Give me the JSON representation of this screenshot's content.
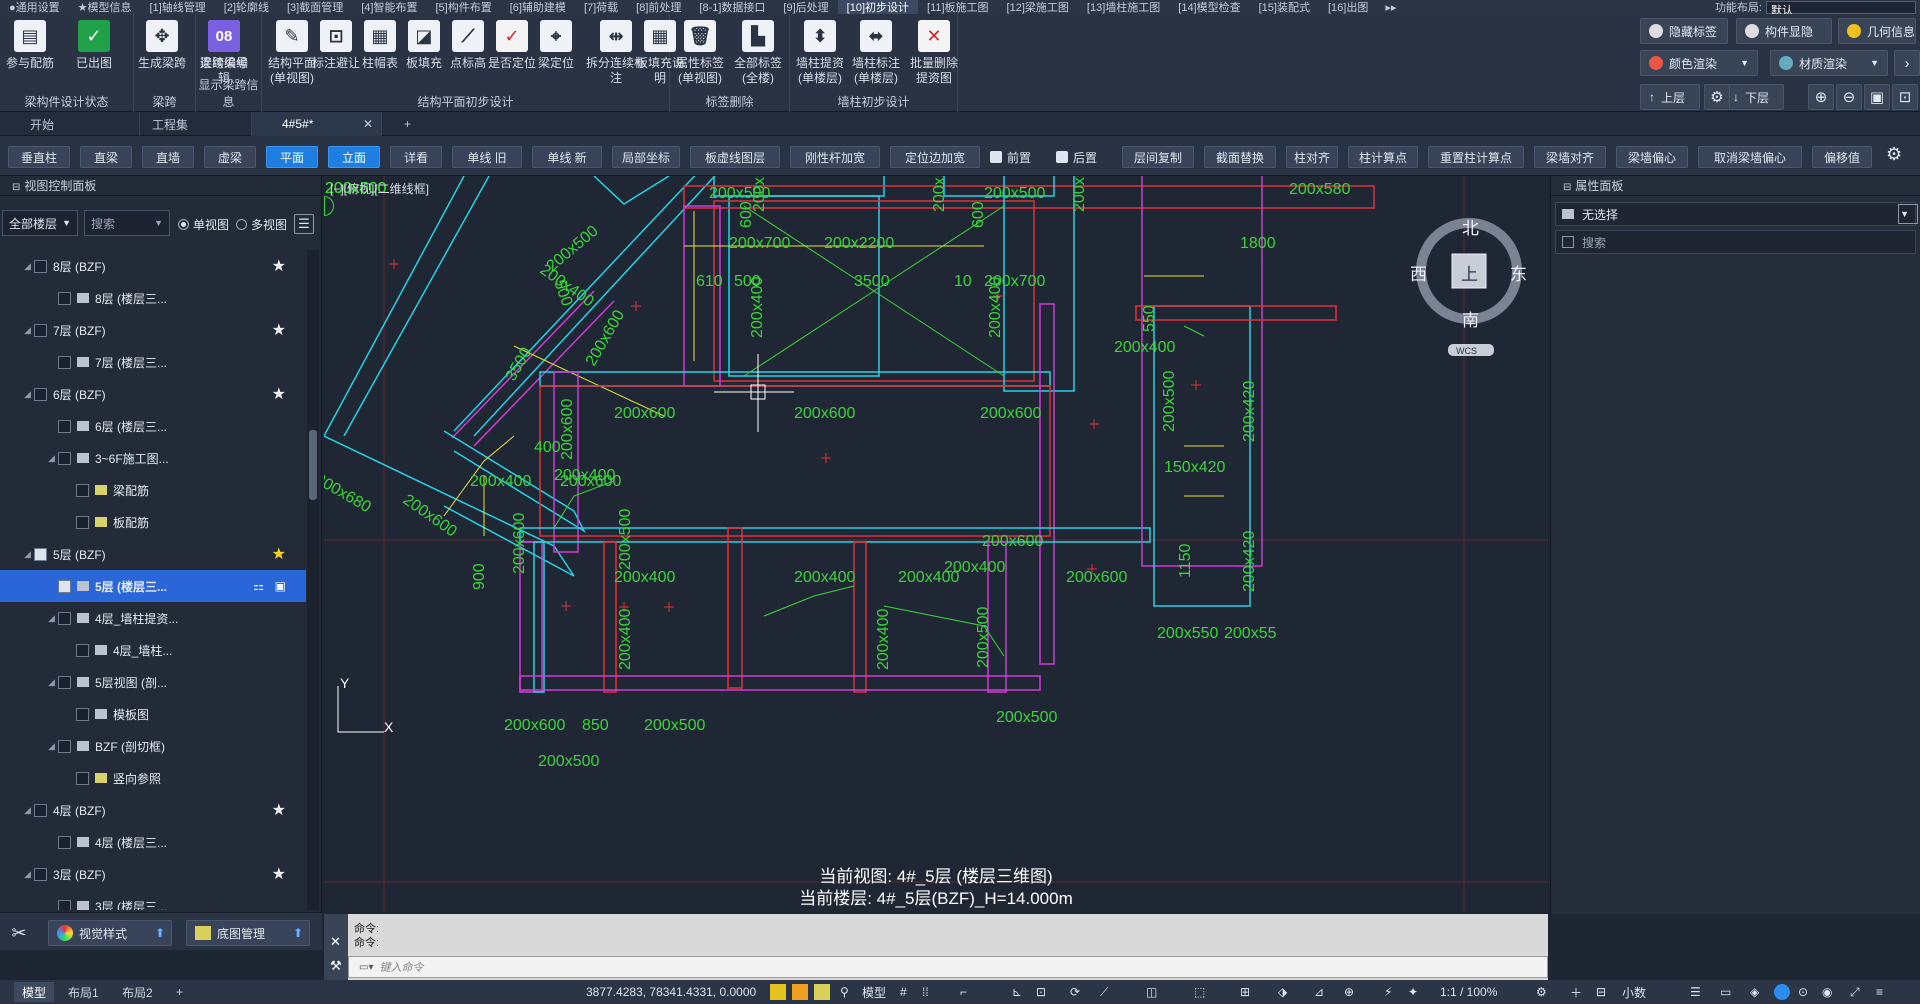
{
  "ribbon_tabs": [
    "●通用设置",
    "★模型信息",
    "[1]轴线管理",
    "[2]轮廓线",
    "[3]截面管理",
    "[4]智能布置",
    "[5]构件布置",
    "[6]辅助建模",
    "[7]荷载",
    "[8]前处理",
    "[8-1]数据接口",
    "[9]后处理",
    "[10]初步设计",
    "[11]板施工图",
    "[12]梁施工图",
    "[13]墙柱施工图",
    "[14]模型检查",
    "[15]装配式",
    "[16]出图"
  ],
  "ribbon_more": "▸▸",
  "layout_label": "功能布局:",
  "layout_value": "默认",
  "ribbon_groups": [
    {
      "label": "梁构件设计状态",
      "buttons": [
        {
          "label": "参与配筋",
          "icon": "reinforcement-icon",
          "glyph": "▤"
        },
        {
          "label": "已出图",
          "icon": "checked-icon",
          "glyph": "✓"
        }
      ]
    },
    {
      "label": "梁跨",
      "buttons": [
        {
          "label": "生成梁跨",
          "icon": "generate-span-icon",
          "glyph": "✥"
        },
        {
          "label": "连续梁编辑",
          "icon": "edit-beam-icon",
          "glyph": "✎"
        }
      ]
    },
    {
      "label": "显示梁跨信息",
      "buttons": [
        {
          "label": "梁跨编号",
          "icon": "span-number-icon",
          "glyph": "08"
        }
      ]
    },
    {
      "label": "结构平面初步设计",
      "buttons": [
        {
          "label": "结构平面(单视图)",
          "icon": "struct-plan-icon",
          "glyph": "✎"
        },
        {
          "label": "标注避让",
          "icon": "annotation-avoid-icon",
          "glyph": "⊡"
        },
        {
          "label": "柱帽表",
          "icon": "column-cap-icon",
          "glyph": "▦"
        },
        {
          "label": "板填充",
          "icon": "slab-fill-icon",
          "glyph": "◪"
        },
        {
          "label": "点标高",
          "icon": "point-elevation-icon",
          "glyph": "⟋"
        },
        {
          "label": "是否定位",
          "icon": "locate-check-icon",
          "glyph": "✓"
        },
        {
          "label": "梁定位",
          "icon": "beam-locate-icon",
          "glyph": "⌖"
        },
        {
          "label": "拆分连续标注",
          "icon": "split-dim-icon",
          "glyph": "⇹"
        },
        {
          "label": "板填充说明",
          "icon": "fill-legend-icon",
          "glyph": "▦"
        }
      ]
    },
    {
      "label": "标签删除",
      "buttons": [
        {
          "label": "属性标签(单视图)",
          "icon": "delete-label-icon",
          "glyph": "🗑"
        },
        {
          "label": "全部标签(全楼)",
          "icon": "delete-all-labels-icon",
          "glyph": "▙"
        }
      ]
    },
    {
      "label": "墙柱初步设计",
      "buttons": [
        {
          "label": "墙柱提资(单楼层)",
          "icon": "wall-column-data-icon",
          "glyph": "⬍"
        },
        {
          "label": "墙柱标注(单楼层)",
          "icon": "wall-column-dim-icon",
          "glyph": "⬌"
        },
        {
          "label": "批量删除提资图",
          "icon": "batch-delete-icon",
          "glyph": "✕"
        }
      ]
    }
  ],
  "right_ribbon": {
    "hide_label": "隐藏标签",
    "component_show": "构件显隐",
    "geometry_info": "几何信息",
    "color_render": "颜色渲染",
    "material_render": "材质渲染",
    "up_floor": "上层",
    "down_floor": "下层"
  },
  "doc_tabs": [
    {
      "label": "开始"
    },
    {
      "label": "工程集"
    },
    {
      "label": "4#5#*"
    }
  ],
  "doc_tab_add": "+",
  "doc_tab_close": "✕",
  "cmd_buttons": [
    "垂直柱",
    "直梁",
    "直墙",
    "虚梁",
    "平面",
    "立面",
    "详看",
    "单线 旧",
    "单线 新",
    "局部坐标",
    "板虚线图层",
    "刚性杆加宽",
    "定位边加宽",
    "前置",
    "后置",
    "层间复制",
    "截面替换",
    "柱对齐",
    "柱计算点",
    "重置柱计算点",
    "梁墙对齐",
    "梁墙偏心",
    "取消梁墙偏心",
    "偏移值"
  ],
  "active_cmds": [
    "平面",
    "立面"
  ],
  "left_panel": {
    "title": "视图控制面板",
    "floor_filter": "全部楼层",
    "search_placeholder": "搜索",
    "single_view": "单视图",
    "multi_view": "多视图",
    "tree": [
      {
        "label": "8层 (BZF)",
        "level": 1,
        "star": "white"
      },
      {
        "label": "8层 (楼层三...",
        "level": 2
      },
      {
        "label": "7层 (BZF)",
        "level": 1,
        "star": "white"
      },
      {
        "label": "7层 (楼层三...",
        "level": 2
      },
      {
        "label": "6层 (BZF)",
        "level": 1,
        "star": "white"
      },
      {
        "label": "6层 (楼层三...",
        "level": 2
      },
      {
        "label": "3~6F施工图...",
        "level": 2,
        "group": true
      },
      {
        "label": "梁配筋",
        "level": 3,
        "yellow": true
      },
      {
        "label": "板配筋",
        "level": 3,
        "yellow": true
      },
      {
        "label": "5层 (BZF)",
        "level": 1,
        "star": "gold",
        "checked": true
      },
      {
        "label": "5层 (楼层三...",
        "level": 2,
        "selected": true,
        "checked": true
      },
      {
        "label": "4层_墙柱提资...",
        "level": 2,
        "group": true
      },
      {
        "label": "4层_墙柱...",
        "level": 3
      },
      {
        "label": "5层视图 (剖...",
        "level": 2,
        "group": true
      },
      {
        "label": "模板图",
        "level": 3
      },
      {
        "label": "BZF (剖切框)",
        "level": 2,
        "group": true
      },
      {
        "label": "竖向参照",
        "level": 3,
        "yellow": true
      },
      {
        "label": "4层 (BZF)",
        "level": 1,
        "star": "white"
      },
      {
        "label": "4层 (楼层三...",
        "level": 2
      },
      {
        "label": "3层 (BZF)",
        "level": 1,
        "star": "white"
      },
      {
        "label": "3层 (楼层三...",
        "level": 2
      }
    ],
    "visual_style": "视觉样式",
    "base_drawing": "底图管理"
  },
  "canvas": {
    "view_label": "[−][俯视][二维线框]",
    "compass": {
      "n": "北",
      "s": "南",
      "e": "东",
      "w": "西",
      "center": "上",
      "wcs": "WCS"
    },
    "current_view_line": "当前视图: 4#_5层 (楼层三维图)",
    "current_floor_line": "当前楼层: 4#_5层(BZF)_H=14.000m",
    "axis_x": "X",
    "axis_y": "Y",
    "labels": [
      "200x500",
      "200x500",
      "200x500",
      "200x500",
      "200x500",
      "200x580",
      "600",
      "600",
      "200x700",
      "200x2200",
      "1800",
      "610",
      "500",
      "3500",
      "10",
      "200x700",
      "200x400",
      "500",
      "200x500",
      "3500",
      "200x600",
      "200x400",
      "200x400",
      "550",
      "200x400",
      "200x600",
      "200x600",
      "200x600",
      "200x500",
      "400",
      "200x600",
      "200x400",
      "150x420",
      "200x680",
      "200x600",
      "200x400",
      "200x600",
      "200x600",
      "200x500",
      "1150",
      "900",
      "200x600",
      "200x400",
      "200x400",
      "200x400",
      "200x400",
      "200x400",
      "200x400",
      "200x600",
      "200x600",
      "200x550",
      "200x55",
      "200x500",
      "200x500",
      "200x500",
      "200x600",
      "850",
      "200x500",
      "200x500",
      "200x600",
      "200x420",
      "200x420"
    ]
  },
  "right_panel": {
    "title": "属性面板",
    "selection": "无选择",
    "search_placeholder": "搜索"
  },
  "command": {
    "line1": "命令:",
    "line2": "命令:",
    "placeholder": "键入命令"
  },
  "status_bar": {
    "tabs": [
      "模型",
      "布局1",
      "布局2"
    ],
    "add": "+",
    "coords": "3877.4283, 78341.4331, 0.0000",
    "mode": "模型",
    "scale": "1:1 / 100%",
    "units": "小数"
  },
  "colors": {
    "accent": "#1f7fe0",
    "selection": "#2a66d8",
    "canvas_bg": "#202734",
    "beam_cyan": "#22d3e6",
    "beam_red": "#e0313a",
    "beam_magenta": "#cf3ad6",
    "dim_yellow": "#e6e23a",
    "label_green": "#3bd43b"
  }
}
